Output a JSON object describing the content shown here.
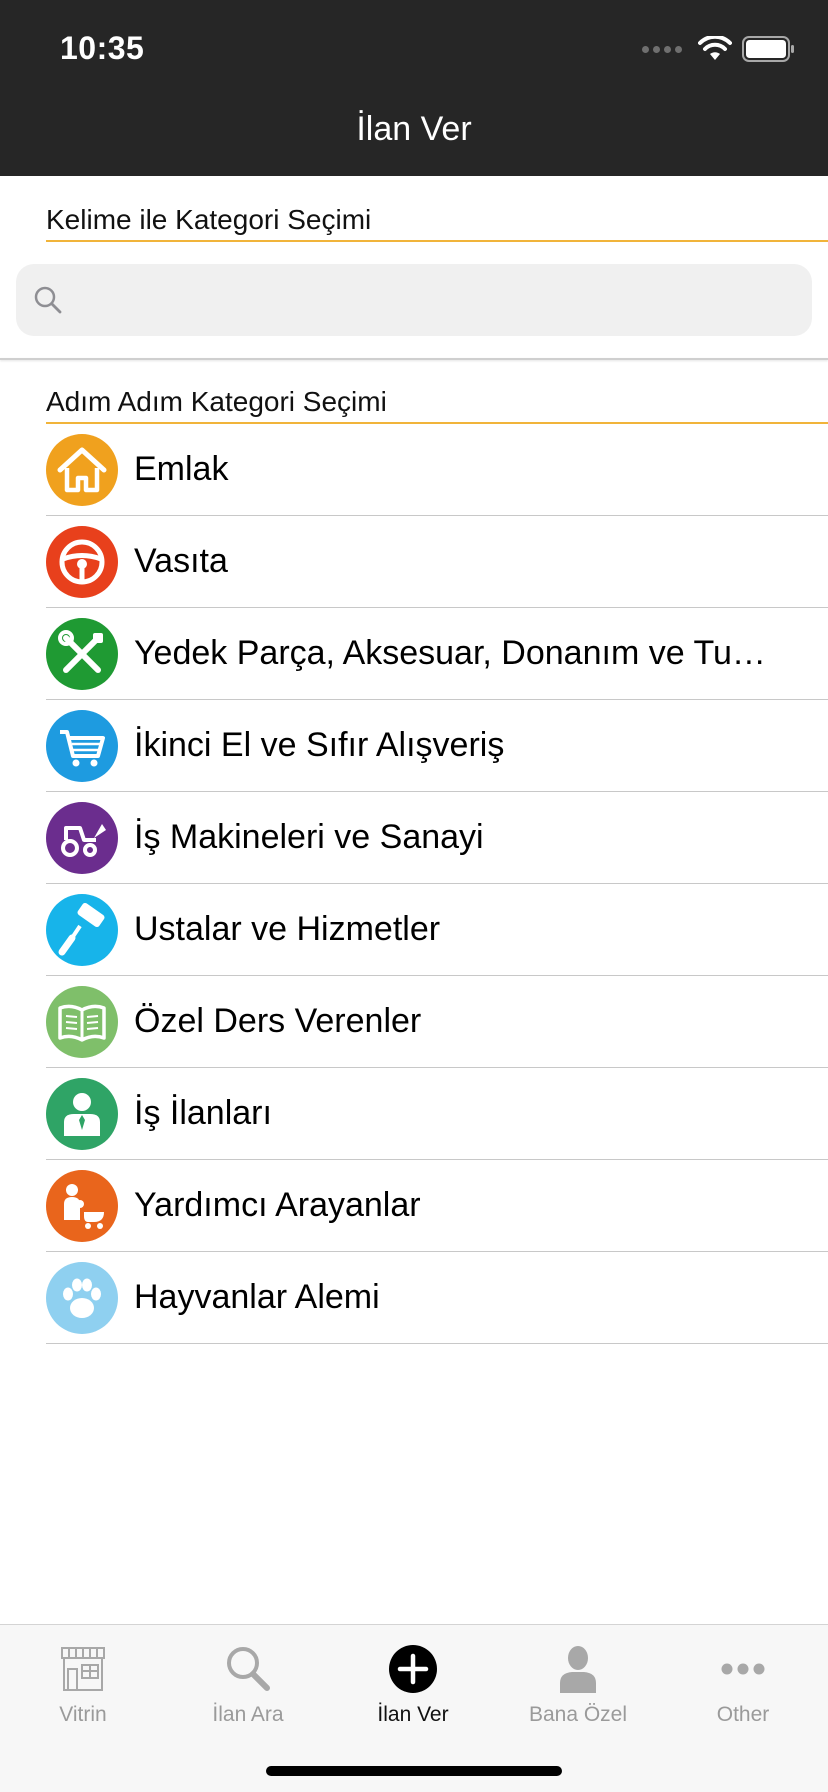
{
  "status_bar": {
    "time": "10:35"
  },
  "header": {
    "title": "İlan Ver"
  },
  "keyword_section": {
    "label": "Kelime ile Kategori Seçimi"
  },
  "search": {
    "value": "",
    "placeholder": ""
  },
  "stepwise_section": {
    "label": "Adım Adım Kategori Seçimi"
  },
  "categories": [
    {
      "label": "Emlak",
      "icon": "house-icon",
      "color": "#f0a11e"
    },
    {
      "label": "Vasıta",
      "icon": "steering-wheel-icon",
      "color": "#e8401c"
    },
    {
      "label": "Yedek Parça, Aksesuar, Donanım ve Tuni...",
      "icon": "tools-icon",
      "color": "#1f9a33"
    },
    {
      "label": "İkinci El ve Sıfır Alışveriş",
      "icon": "shopping-cart-icon",
      "color": "#1e9be0"
    },
    {
      "label": "İş Makineleri ve Sanayi",
      "icon": "tractor-icon",
      "color": "#6b2d8e"
    },
    {
      "label": "Ustalar ve Hizmetler",
      "icon": "paint-roller-icon",
      "color": "#17b4ea"
    },
    {
      "label": "Özel Ders Verenler",
      "icon": "book-icon",
      "color": "#7fbf6a"
    },
    {
      "label": "İş İlanları",
      "icon": "businessman-icon",
      "color": "#2fa466"
    },
    {
      "label": "Yardımcı Arayanlar",
      "icon": "caregiver-icon",
      "color": "#e9651c"
    },
    {
      "label": "Hayvanlar Alemi",
      "icon": "paw-icon",
      "color": "#8fd0f0"
    }
  ],
  "tabbar": {
    "tabs": [
      {
        "label": "Vitrin",
        "icon": "storefront-icon",
        "active": false
      },
      {
        "label": "İlan Ara",
        "icon": "search-icon",
        "active": false
      },
      {
        "label": "İlan Ver",
        "icon": "plus-circle-icon",
        "active": true
      },
      {
        "label": "Bana Özel",
        "icon": "person-icon",
        "active": false
      },
      {
        "label": "Other",
        "icon": "more-icon",
        "active": false
      }
    ]
  },
  "colors": {
    "header_bg": "#262626",
    "accent_line": "#f1b43a",
    "search_bg": "#f0f0f0"
  }
}
